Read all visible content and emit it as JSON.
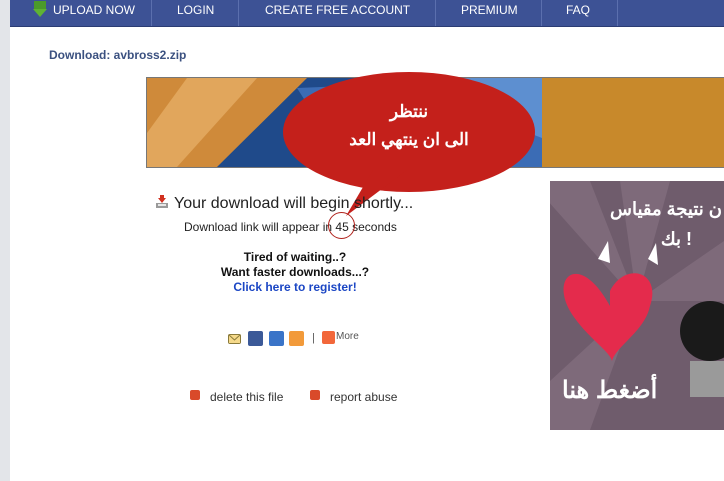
{
  "nav": {
    "items": [
      {
        "label": "UPLOAD NOW"
      },
      {
        "label": "LOGIN"
      },
      {
        "label": "CREATE FREE ACCOUNT"
      },
      {
        "label": "PREMIUM"
      },
      {
        "label": "FAQ"
      }
    ]
  },
  "download": {
    "title": "Download: avbross2.zip",
    "begin_text": "Your download will begin shortly...",
    "link_text_before": "Download link will appear in",
    "countdown": "45",
    "link_text_after": "seconds"
  },
  "annotation": {
    "line1": "ننتظر",
    "line2": "الى ان ينتهي العد"
  },
  "promo": {
    "tired": "Tired of waiting..?",
    "faster": "Want faster downloads...?",
    "register": "Click here to register!"
  },
  "share": {
    "more": "More",
    "icons": [
      "email-icon",
      "facebook-icon",
      "delicious-icon",
      "blogger-icon",
      "more-plus-icon"
    ]
  },
  "actions": {
    "delete": "delete this file",
    "report": "report abuse"
  },
  "ad": {
    "line1": "ن نتيجة مقياس",
    "line2": "بك !",
    "cta": "أضغط هنا"
  },
  "colors": {
    "nav_bg": "#3d5295",
    "bubble": "#c4201b",
    "link": "#1b46c4",
    "title": "#3b5180"
  }
}
